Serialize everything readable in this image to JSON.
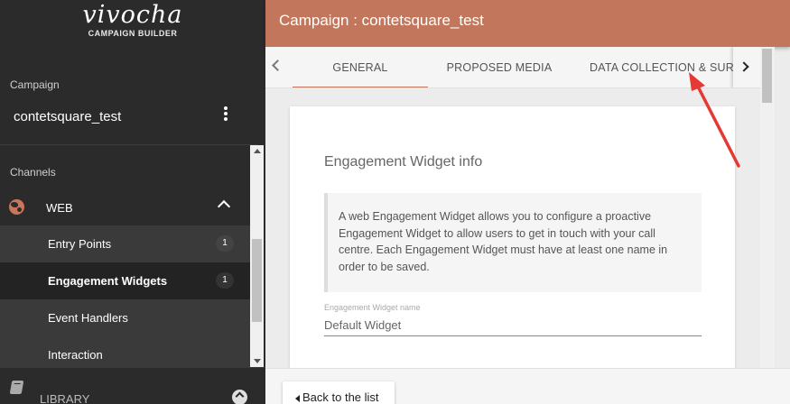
{
  "logo": {
    "name": "vivocha",
    "subtitle": "CAMPAIGN BUILDER"
  },
  "sidebar": {
    "campaign_label": "Campaign",
    "campaign_name": "contetsquare_test",
    "channels_label": "Channels",
    "web_label": "WEB",
    "items": [
      {
        "label": "Entry Points",
        "count": "1"
      },
      {
        "label": "Engagement Widgets",
        "count": "1"
      },
      {
        "label": "Event Handlers"
      },
      {
        "label": "Interaction"
      }
    ],
    "library_label": "LIBRARY"
  },
  "header": {
    "title": "Campaign : contetsquare_test"
  },
  "tabs": [
    {
      "label": "GENERAL"
    },
    {
      "label": "PROPOSED MEDIA"
    },
    {
      "label": "DATA COLLECTION & SURVEY"
    }
  ],
  "card": {
    "title": "Engagement Widget info",
    "info": "A web Engagement Widget allows you to configure a proactive Engagement Widget to allow users to get in touch with your call centre. Each Engagement Widget must have at least one name in order to be saved.",
    "field_label": "Engagement Widget name",
    "field_value": "Default Widget"
  },
  "footer": {
    "back_label": "Back to the list"
  },
  "colors": {
    "accent": "#c2765b",
    "sidebar_bg": "#2b2b2b",
    "annotation_arrow": "#e53935"
  }
}
